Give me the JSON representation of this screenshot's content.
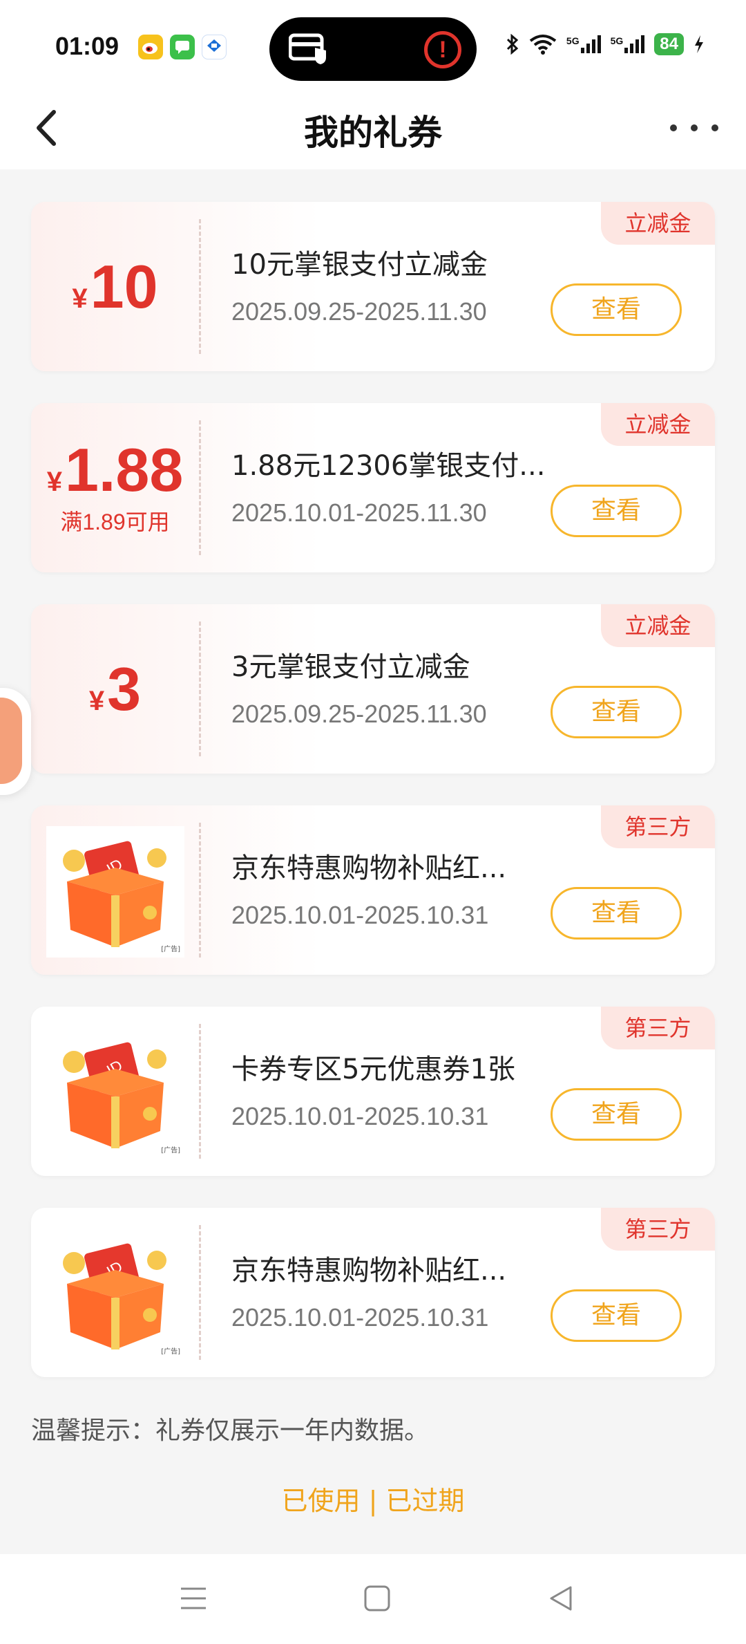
{
  "status_bar": {
    "time": "01:09",
    "battery": "84",
    "signal_labels": [
      "5G",
      "5G"
    ],
    "apps": [
      "weibo-icon",
      "messages-icon",
      "bank-app-icon"
    ]
  },
  "header": {
    "title": "我的礼券"
  },
  "coupons": [
    {
      "tag": "立减金",
      "yen": "¥",
      "amount": "10",
      "condition": "",
      "title": "10元掌银支付立减金",
      "date": "2025.09.25-2025.11.30",
      "button": "查看"
    },
    {
      "tag": "立减金",
      "yen": "¥",
      "amount": "1.88",
      "condition": "满1.89可用",
      "title": "1.88元12306掌银支付...",
      "date": "2025.10.01-2025.11.30",
      "button": "查看"
    },
    {
      "tag": "立减金",
      "yen": "¥",
      "amount": "3",
      "condition": "",
      "title": "3元掌银支付立减金",
      "date": "2025.09.25-2025.11.30",
      "button": "查看"
    },
    {
      "tag": "第三方",
      "title": "京东特惠购物补贴红...",
      "date": "2025.10.01-2025.10.31",
      "button": "查看",
      "ad_label": "[广告]"
    },
    {
      "tag": "第三方",
      "title": "卡券专区5元优惠券1张",
      "date": "2025.10.01-2025.10.31",
      "button": "查看",
      "ad_label": "[广告]"
    },
    {
      "tag": "第三方",
      "title": "京东特惠购物补贴红...",
      "date": "2025.10.01-2025.10.31",
      "button": "查看",
      "ad_label": "[广告]"
    }
  ],
  "footer": {
    "tip": "温馨提示：礼券仅展示一年内数据。",
    "used_link": "已使用",
    "separator": "|",
    "expired_link": "已过期"
  },
  "colors": {
    "accent_red": "#e0342c",
    "accent_orange": "#f0a41c",
    "background": "#f5f5f5"
  }
}
